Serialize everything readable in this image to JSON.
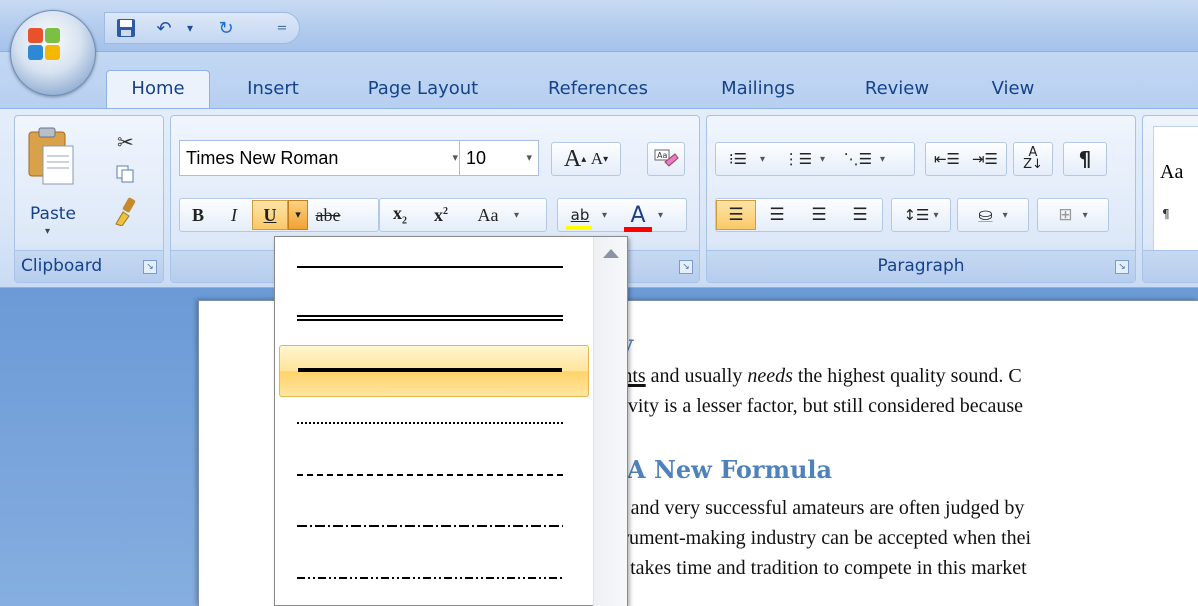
{
  "app": {
    "qat_more": "="
  },
  "tabs": [
    "Home",
    "Insert",
    "Page Layout",
    "References",
    "Mailings",
    "Review",
    "View"
  ],
  "clipboard": {
    "paste_label": "Paste",
    "group_label": "Clipboard"
  },
  "font": {
    "font_name": "Times New Roman",
    "font_size": "10",
    "grow_label": "A",
    "shrink_label": "A",
    "bold": "B",
    "italic": "I",
    "underline": "U",
    "strike": "abe",
    "subscript": "x",
    "superscript": "x",
    "change_case": "Aa",
    "highlight": "ab",
    "font_color": "A"
  },
  "paragraph": {
    "group_label": "Paragraph"
  },
  "styles": {
    "preview": "Aa",
    "pilcrow": "¶"
  },
  "underline_dropdown": {
    "options": [
      "single",
      "double",
      "thick",
      "dotted",
      "dashed",
      "dot-dash",
      "dot-dot-dash"
    ],
    "highlighted": "thick"
  },
  "document": {
    "heading1": "ity",
    "line1_pre": "",
    "line1_underlined": "wants",
    "line1_mid": " and usually ",
    "line1_italic": "needs",
    "line1_post": " the highest quality sound. C",
    "line2": "ngevity is a lesser factor, but still considered because",
    "heading2": "A New Formula",
    "line3": "ans and very successful amateurs are often judged by",
    "line4": "nstrument-making industry can be accepted when thei",
    "line5": "y it takes time and tradition to compete in this market"
  },
  "colors": {
    "highlight_bar": "#ffff00",
    "font_color_bar": "#ff0000",
    "heading": "#4f81bd"
  }
}
